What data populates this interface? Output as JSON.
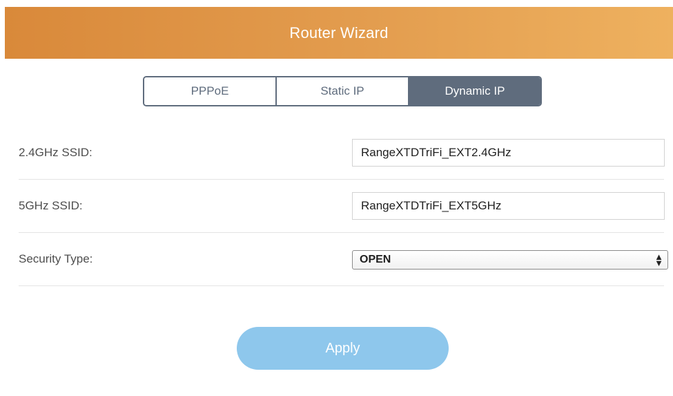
{
  "header": {
    "title": "Router Wizard",
    "color": "#e39d4f"
  },
  "tabs": [
    {
      "label": "PPPoE",
      "active": false
    },
    {
      "label": "Static IP",
      "active": false
    },
    {
      "label": "Dynamic IP",
      "active": true
    }
  ],
  "form": {
    "ssid_24": {
      "label": "2.4GHz SSID:",
      "value": "RangeXTDTriFi_EXT2.4GHz"
    },
    "ssid_5": {
      "label": "5GHz SSID:",
      "value": "RangeXTDTriFi_EXT5GHz"
    },
    "security": {
      "label": "Security Type:",
      "selected": "OPEN",
      "icon": "select-arrows-icon"
    }
  },
  "apply": {
    "label": "Apply",
    "color": "#8ec7ec"
  },
  "colors": {
    "accent": "#5f6c7d",
    "text": "#4e4e4e"
  }
}
